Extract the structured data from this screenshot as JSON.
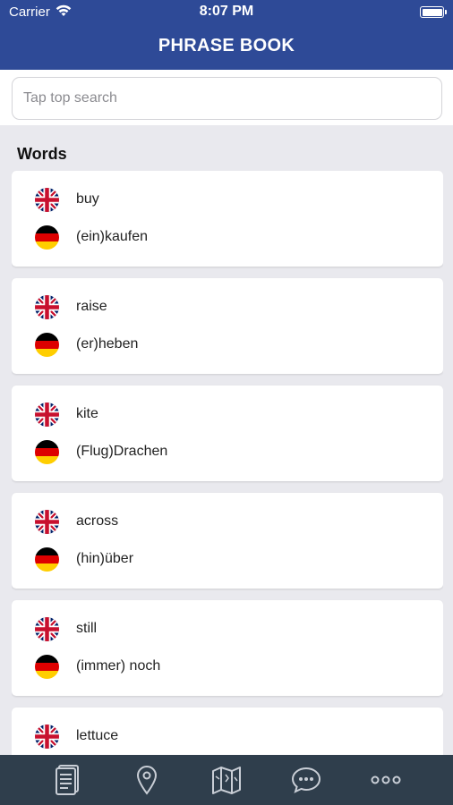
{
  "status_bar": {
    "carrier": "Carrier",
    "time": "8:07 PM",
    "wifi_icon": "wifi-icon",
    "battery_icon": "battery-icon"
  },
  "header": {
    "title": "PHRASE BOOK",
    "background_color": "#2e4a97"
  },
  "search": {
    "placeholder": "Tap top search",
    "value": ""
  },
  "section": {
    "title": "Words"
  },
  "words": [
    {
      "en": "buy",
      "de": "(ein)kaufen"
    },
    {
      "en": "raise",
      "de": "(er)heben"
    },
    {
      "en": "kite",
      "de": "(Flug)Drachen"
    },
    {
      "en": "across",
      "de": "(hin)über"
    },
    {
      "en": "still",
      "de": "(immer) noch"
    },
    {
      "en": "lettuce",
      "de": ""
    }
  ],
  "flags": {
    "en_icon": "uk-flag-icon",
    "de_icon": "germany-flag-icon"
  },
  "tabbar": {
    "background_color": "#2f3e4c",
    "tabs": [
      {
        "icon": "phrasebook-icon",
        "active": true
      },
      {
        "icon": "location-pin-icon",
        "active": false
      },
      {
        "icon": "map-icon",
        "active": false
      },
      {
        "icon": "chat-icon",
        "active": false
      },
      {
        "icon": "more-icon",
        "active": false
      }
    ]
  }
}
